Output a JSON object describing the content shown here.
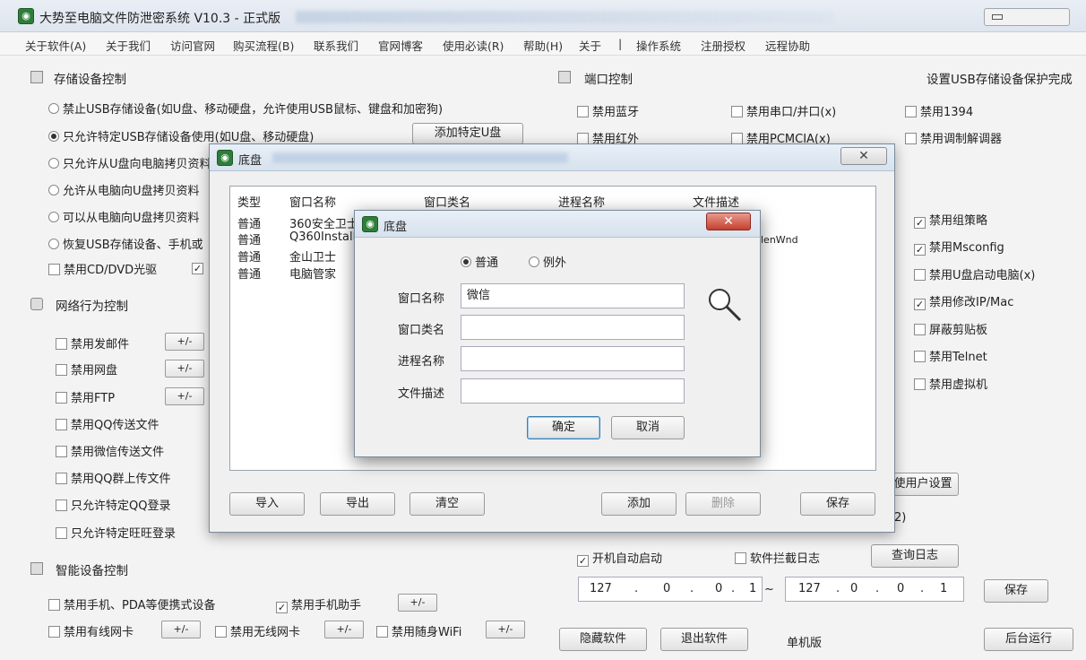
{
  "window": {
    "title": "大势至电脑文件防泄密系统 V10.3 - 正式版"
  },
  "menu": [
    "关于软件(A)",
    "关于我们",
    "访问官网",
    "购买流程(B)",
    "联系我们",
    "官网博客",
    "使用必读(R)",
    "帮助(H)",
    "关于",
    "|",
    "操作系统",
    "注册授权",
    "远程协助"
  ],
  "storage": {
    "title": "存储设备控制",
    "status": "设置USB存储设备保护完成",
    "options": [
      {
        "label": "禁止USB存储设备(如U盘、移动硬盘，允许使用USB鼠标、键盘和加密狗)",
        "selected": false
      },
      {
        "label": "只允许特定USB存储设备使用(如U盘、移动硬盘)",
        "selected": true
      },
      {
        "label": "只允许从U盘向电脑拷贝资料",
        "selected": false
      },
      {
        "label": "允许从电脑向U盘拷贝资料",
        "selected": false
      },
      {
        "label": "可以从电脑向U盘拷贝资料",
        "selected": false
      },
      {
        "label": "恢复USB存储设备、手机或",
        "selected": false
      }
    ],
    "add_button": "添加特定U盘",
    "cd_label": "禁用CD/DVD光驱",
    "cd_checked": false,
    "cd_extra_checked": true
  },
  "ports": {
    "title": "端口控制",
    "row1": [
      {
        "label": "禁用蓝牙",
        "checked": false
      },
      {
        "label": "禁用串口/并口(x)",
        "checked": false
      },
      {
        "label": "禁用1394",
        "checked": false
      }
    ],
    "row2": [
      {
        "label": "禁用红外",
        "checked": false
      },
      {
        "label": "禁用PCMCIA(x)",
        "checked": false
      },
      {
        "label": "禁用调制解调器",
        "checked": false
      }
    ],
    "right": [
      {
        "label": "禁用组策略",
        "checked": true
      },
      {
        "label": "禁用Msconfig",
        "checked": true
      },
      {
        "label": "禁用U盘启动电脑(x)",
        "checked": false
      },
      {
        "label": "禁用修改IP/Mac",
        "checked": true
      },
      {
        "label": "屏蔽剪贴板",
        "checked": false
      },
      {
        "label": "禁用Telnet",
        "checked": false
      },
      {
        "label": "禁用虚拟机",
        "checked": false
      }
    ]
  },
  "network": {
    "title": "网络行为控制",
    "items": [
      {
        "label": "禁用发邮件",
        "checked": false,
        "pm": "+/-"
      },
      {
        "label": "禁用网盘",
        "checked": false,
        "pm": "+/-"
      },
      {
        "label": "禁用FTP",
        "checked": false,
        "pm": "+/-"
      },
      {
        "label": "禁用QQ传送文件",
        "checked": false
      },
      {
        "label": "禁用微信传送文件",
        "checked": false
      },
      {
        "label": "禁用QQ群上传文件",
        "checked": false
      },
      {
        "label": "只允许特定QQ登录",
        "checked": false
      },
      {
        "label": "只允许特定旺旺登录",
        "checked": false
      }
    ]
  },
  "smart": {
    "title": "智能设备控制",
    "row1": [
      {
        "label": "禁用手机、PDA等便携式设备",
        "checked": false
      },
      {
        "label": "禁用手机助手",
        "checked": true,
        "pm": "+/-"
      }
    ],
    "row2": [
      {
        "label": "禁用有线网卡",
        "checked": false,
        "pm": "+/-"
      },
      {
        "label": "禁用无线网卡",
        "checked": false,
        "pm": "+/-"
      },
      {
        "label": "禁用随身WiFi",
        "checked": false,
        "pm": "+/-"
      }
    ]
  },
  "bottom": {
    "user_settings": "使用户设置",
    "partial_text": "2)",
    "autostart": {
      "label": "开机自动启动",
      "checked": true
    },
    "intercept_log": {
      "label": "软件拦截日志",
      "checked": false
    },
    "view_log": "查询日志",
    "ip_from": [
      "127",
      ".",
      "0",
      ".",
      "0",
      ".",
      "1"
    ],
    "ip_sep": "~",
    "ip_to": [
      "127",
      ".",
      "0",
      ".",
      "0",
      ".",
      "1"
    ],
    "save": "保存",
    "hide": "隐藏软件",
    "exit": "退出软件",
    "edition": "单机版",
    "background": "后台运行"
  },
  "list_dialog": {
    "title": "底盘",
    "columns": [
      "类型",
      "窗口名称",
      "窗口类名",
      "进程名称",
      "文件描述"
    ],
    "rows": [
      {
        "type": "普通",
        "name": "360安全卫士"
      },
      {
        "type": "普通",
        "name": "Q360Installer"
      },
      {
        "type": "普通",
        "name": "金山卫士"
      },
      {
        "type": "普通",
        "name": "电脑管家"
      }
    ],
    "row1_tail": "lenWnd",
    "buttons": {
      "import": "导入",
      "export": "导出",
      "clear": "清空",
      "add": "添加",
      "delete": "删除",
      "save": "保存"
    }
  },
  "add_dialog": {
    "title": "底盘",
    "mode": {
      "normal": "普通",
      "exception": "例外",
      "selected": "normal"
    },
    "fields": [
      {
        "label": "窗口名称",
        "value": "微信"
      },
      {
        "label": "窗口类名",
        "value": ""
      },
      {
        "label": "进程名称",
        "value": ""
      },
      {
        "label": "文件描述",
        "value": ""
      }
    ],
    "ok": "确定",
    "cancel": "取消"
  }
}
